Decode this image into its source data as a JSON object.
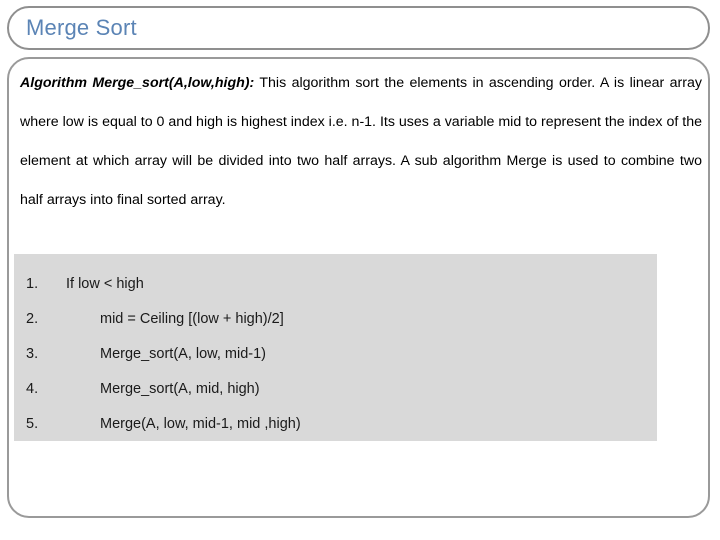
{
  "slide": {
    "title": "Merge Sort",
    "title_color": "#5b84b5",
    "border_color": "#9a9a9a",
    "steps_box_color": "#d9d9d9"
  },
  "paragraph": {
    "lead": "Algorithm Merge_sort(A,low,high):",
    "body": " This algorithm sort the elements in ascending order. A is linear array where low is equal to 0 and high is highest index i.e. n-1. Its uses a variable mid to represent the index of the element at which array will be divided into two half arrays. A sub algorithm Merge is used to combine two half arrays into final sorted array."
  },
  "steps": [
    {
      "num": "1.",
      "text": "If  low < high",
      "level": 1
    },
    {
      "num": "2.",
      "text": "mid = Ceiling [(low + high)/2]",
      "level": 2
    },
    {
      "num": "3.",
      "text": "Merge_sort(A, low, mid-1)",
      "level": 2
    },
    {
      "num": "4.",
      "text": "Merge_sort(A, mid, high)",
      "level": 2
    },
    {
      "num": "5.",
      "text": "Merge(A, low, mid-1, mid ,high)",
      "level": 2
    }
  ]
}
